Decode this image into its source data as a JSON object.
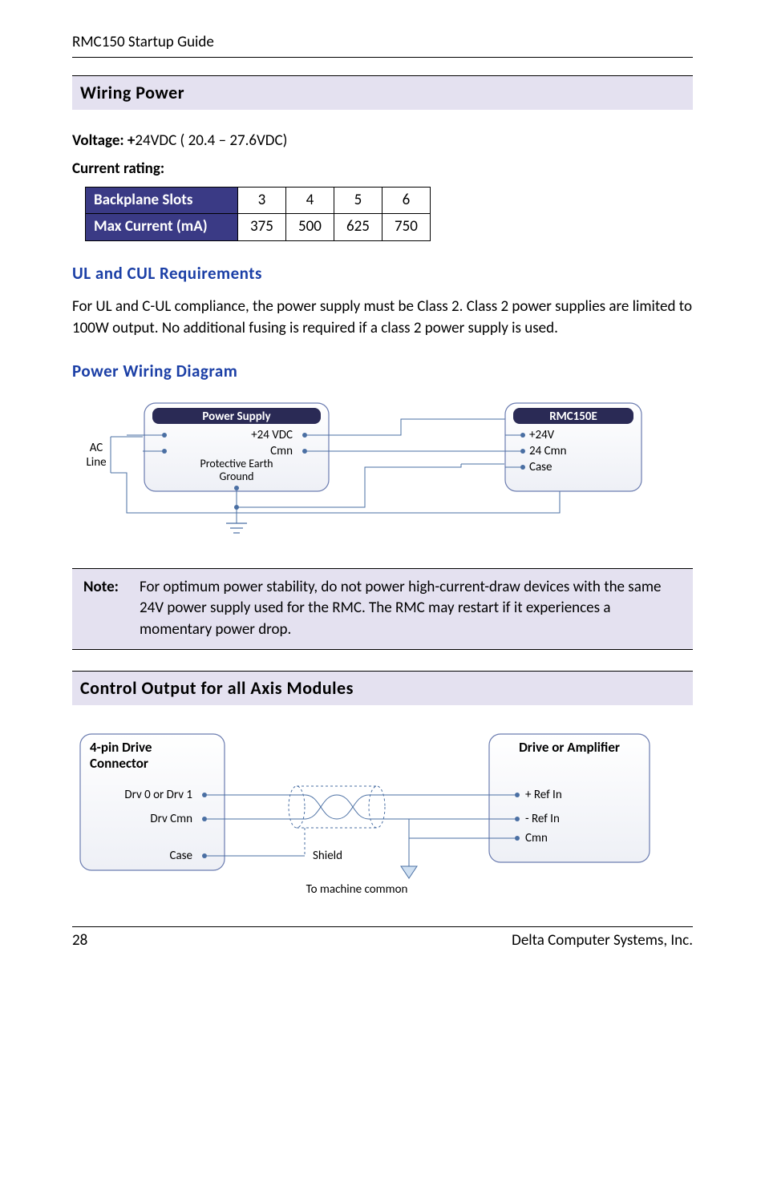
{
  "header": "RMC150 Startup Guide",
  "section1": "Wiring Power",
  "voltage_label": "Voltage: +",
  "voltage_value": "24VDC ( 20.4 – 27.6VDC)",
  "current_label": "Current rating:",
  "table": {
    "row1": {
      "head": "Backplane Slots",
      "c1": "3",
      "c2": "4",
      "c3": "5",
      "c4": "6"
    },
    "row2": {
      "head": "Max Current (mA)",
      "c1": "375",
      "c2": "500",
      "c3": "625",
      "c4": "750"
    }
  },
  "sub1": "UL and CUL Requirements",
  "para1": "For UL and C-UL compliance, the power supply must be Class 2. Class 2 power supplies are limited to 100W output. No additional fusing is required if a class 2 power supply is used.",
  "sub2": "Power Wiring Diagram",
  "diagram1": {
    "ac_line_1": "AC",
    "ac_line_2": "Line",
    "ps_title": "Power Supply",
    "ps_24v": "+24 VDC",
    "ps_cmn": "Cmn",
    "ps_pe1": "Protective Earth",
    "ps_pe2": "Ground",
    "rmc_title": "RMC150E",
    "rmc_24v": "+24V",
    "rmc_cmn": "24 Cmn",
    "rmc_case": "Case"
  },
  "note_label": "Note:",
  "note_text": "For optimum power stability, do not power high-current-draw devices with the same 24V power supply used for the RMC. The RMC may restart if it experiences a momentary power drop.",
  "section2": "Control Output for all Axis Modules",
  "diagram2": {
    "conn_title_1": "4-pin Drive",
    "conn_title_2": "Connector",
    "drv01": "Drv 0 or Drv 1",
    "drvcmn": "Drv Cmn",
    "case": "Case",
    "shield": "Shield",
    "tomc": "To machine common",
    "amp_title": "Drive or Amplifier",
    "refin_p": "+ Ref In",
    "refin_n": "- Ref In",
    "amp_cmn": "Cmn"
  },
  "footer": {
    "page": "28",
    "company": "Delta Computer Systems, Inc."
  },
  "chart_data": {
    "type": "table",
    "title": "Current rating",
    "columns": [
      "Backplane Slots",
      "3",
      "4",
      "5",
      "6"
    ],
    "rows": [
      {
        "label": "Max Current (mA)",
        "values": [
          375,
          500,
          625,
          750
        ]
      }
    ]
  }
}
